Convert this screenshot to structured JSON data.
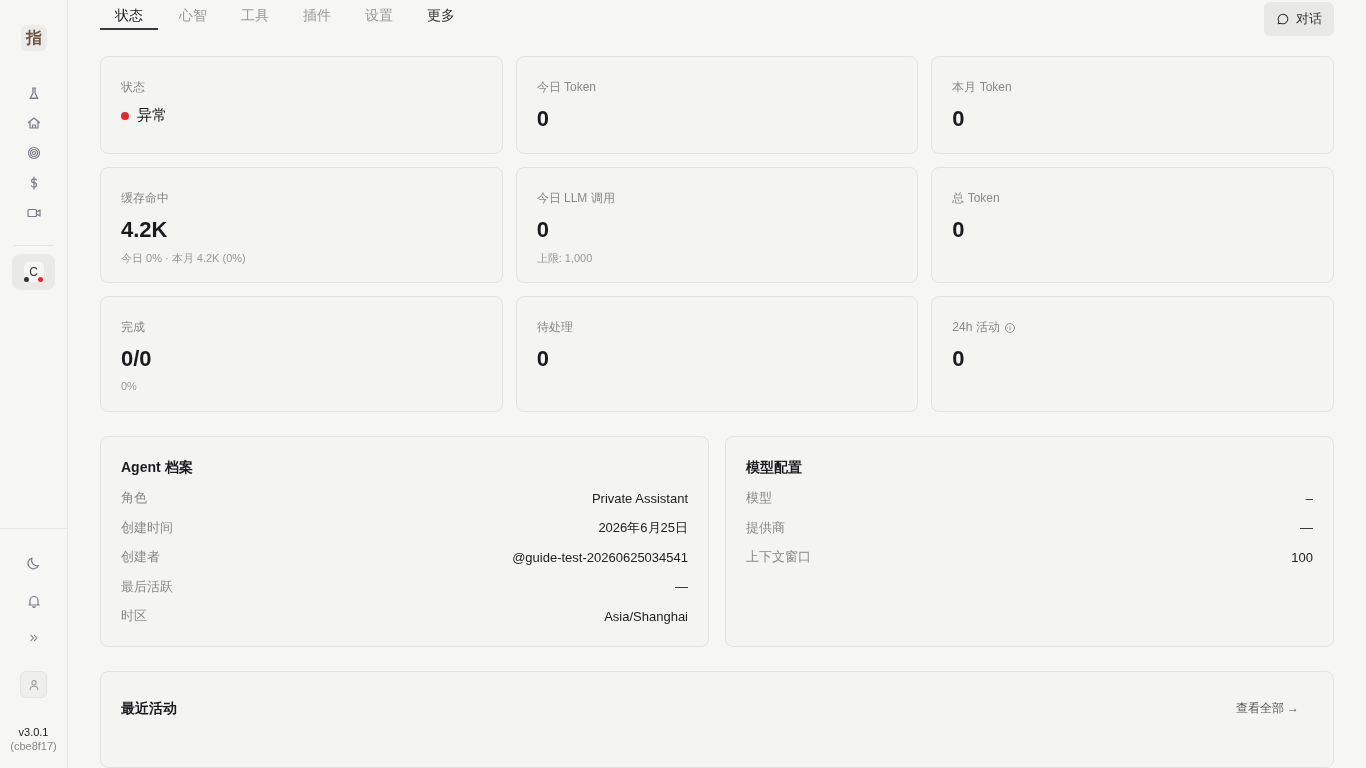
{
  "sidebar": {
    "logo": "指",
    "agent_avatar": "C",
    "version": "v3.0.1",
    "build": "(cbe8f17)"
  },
  "tabs": [
    {
      "label": "状态",
      "selected": true,
      "kind": "tab"
    },
    {
      "label": "心智",
      "selected": false,
      "kind": "tab"
    },
    {
      "label": "工具",
      "selected": false,
      "kind": "tab"
    },
    {
      "label": "插件",
      "selected": false,
      "kind": "tab"
    },
    {
      "label": "设置",
      "selected": false,
      "kind": "tab"
    },
    {
      "label": "更多",
      "selected": false,
      "kind": "menu"
    }
  ],
  "chat_button": "对话",
  "stats": [
    {
      "kind": "status",
      "label": "状态",
      "value": "异常",
      "color": "#e5262b"
    },
    {
      "kind": "number",
      "label": "今日 Token",
      "value": "0"
    },
    {
      "kind": "number",
      "label": "本月 Token",
      "value": "0"
    },
    {
      "kind": "number",
      "label": "缓存命中",
      "value": "4.2K",
      "note": "今日 0% · 本月 4.2K (0%)"
    },
    {
      "kind": "number",
      "label": "今日 LLM 调用",
      "value": "0",
      "note": "上限: 1,000"
    },
    {
      "kind": "number",
      "label": "总 Token",
      "value": "0"
    },
    {
      "kind": "number",
      "label": "完成",
      "value": "0/0",
      "note": "0%"
    },
    {
      "kind": "number",
      "label": "待处理",
      "value": "0"
    },
    {
      "kind": "info",
      "label": "24h 活动",
      "value": "0"
    }
  ],
  "agent_profile": {
    "title": "Agent 档案",
    "rows": [
      {
        "label": "角色",
        "value": "Private Assistant"
      },
      {
        "label": "创建时间",
        "value": "2026年6月25日"
      },
      {
        "label": "创建者",
        "value": "@guide-test-20260625034541"
      },
      {
        "label": "最后活跃",
        "value": "—"
      },
      {
        "label": "时区",
        "value": "Asia/Shanghai"
      }
    ]
  },
  "model_config": {
    "title": "模型配置",
    "rows": [
      {
        "label": "模型",
        "value": "–"
      },
      {
        "label": "提供商",
        "value": "—"
      },
      {
        "label": "上下文窗口",
        "value": "100"
      }
    ]
  },
  "recent_activity": {
    "title": "最近活动",
    "view_all": "查看全部 →"
  }
}
